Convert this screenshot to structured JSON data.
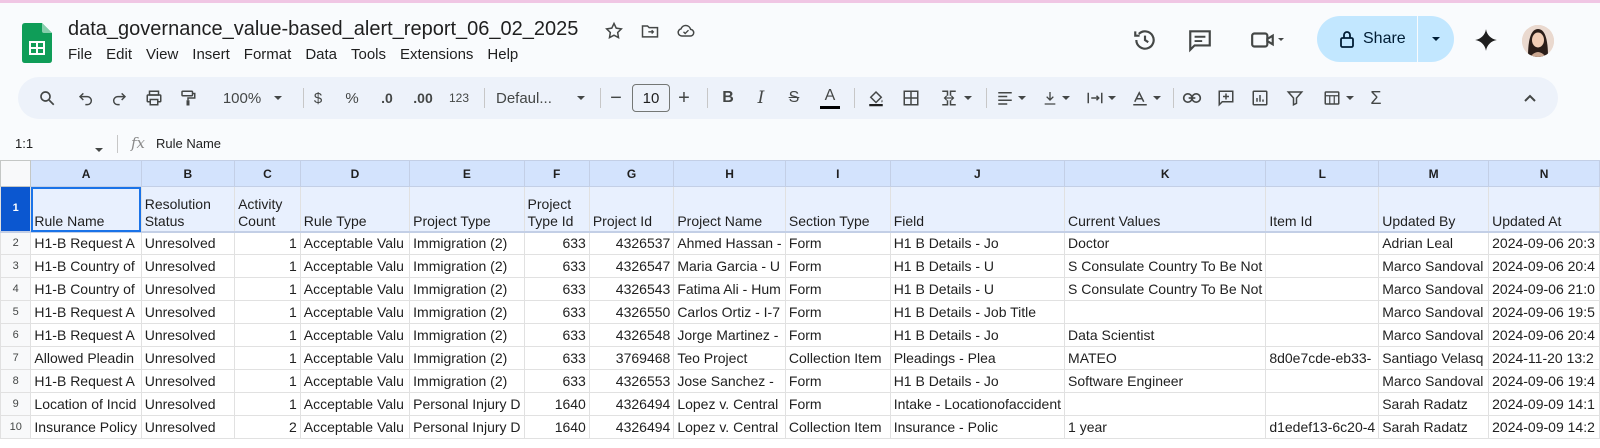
{
  "header": {
    "doc_title": "data_governance_value-based_alert_report_06_02_2025",
    "menu": [
      "File",
      "Edit",
      "View",
      "Insert",
      "Format",
      "Data",
      "Tools",
      "Extensions",
      "Help"
    ],
    "share_label": "Share"
  },
  "toolbar": {
    "zoom": "100%",
    "currency": "$",
    "percent": "%",
    "decrease_decimal": ".0",
    "increase_decimal": ".00",
    "number_format": "123",
    "font": "Defaul...",
    "font_size": "10",
    "minus": "−",
    "plus": "+",
    "bold": "B",
    "italic": "I",
    "strike": "S",
    "text_color": "A",
    "sum": "Σ"
  },
  "formula_bar": {
    "cell_ref": "1:1",
    "fx": "fx",
    "content": "Rule Name"
  },
  "columns": [
    "A",
    "B",
    "C",
    "D",
    "E",
    "F",
    "G",
    "H",
    "I",
    "J",
    "K",
    "L",
    "M",
    "N"
  ],
  "header_row": {
    "number": "1",
    "cells": [
      "Rule Name",
      "Resolution Status",
      "Activity Count",
      "Rule Type",
      "Project Type",
      "Project Type  Id",
      "Project  Id",
      "Project  Name",
      "Section Type",
      "Field",
      "Current Values",
      "Item Id",
      "Updated By",
      "Updated At"
    ]
  },
  "rows": [
    {
      "n": "2",
      "c": [
        "H1-B Request A",
        "Unresolved",
        "1",
        "Acceptable Valu",
        "Immigration (2)",
        "633",
        "4326537",
        "Ahmed Hassan -",
        "Form",
        "H1 B Details - Jo",
        "Doctor",
        "",
        "Adrian Leal",
        "2024-09-06 20:3"
      ]
    },
    {
      "n": "3",
      "c": [
        "H1-B Country of",
        "Unresolved",
        "1",
        "Acceptable Valu",
        "Immigration (2)",
        "633",
        "4326547",
        "Maria Garcia - U",
        "Form",
        "H1 B Details - U",
        "S Consulate Country To Be Not",
        "",
        "Marco Sandoval",
        "2024-09-06 20:4"
      ]
    },
    {
      "n": "4",
      "c": [
        "H1-B Country of",
        "Unresolved",
        "1",
        "Acceptable Valu",
        "Immigration (2)",
        "633",
        "4326543",
        "Fatima Ali - Hum",
        "Form",
        "H1 B Details - U",
        "S Consulate Country To Be Not",
        "",
        "Marco Sandoval",
        "2024-09-06 21:0"
      ]
    },
    {
      "n": "5",
      "c": [
        "H1-B Request A",
        "Unresolved",
        "1",
        "Acceptable Valu",
        "Immigration (2)",
        "633",
        "4326550",
        "Carlos Ortiz - I-7",
        "Form",
        "H1 B Details - Job Title",
        "",
        "",
        "Marco Sandoval",
        "2024-09-06 19:5"
      ]
    },
    {
      "n": "6",
      "c": [
        "H1-B Request A",
        "Unresolved",
        "1",
        "Acceptable Valu",
        "Immigration (2)",
        "633",
        "4326548",
        "Jorge Martinez -",
        "Form",
        "H1 B Details - Jo",
        "Data Scientist",
        "",
        "Marco Sandoval",
        "2024-09-06 20:4"
      ]
    },
    {
      "n": "7",
      "c": [
        "Allowed Pleadin",
        "Unresolved",
        "1",
        "Acceptable Valu",
        "Immigration (2)",
        "633",
        "3769468",
        "Teo Project",
        "Collection Item",
        "Pleadings - Plea",
        "MATEO",
        "8d0e7cde-eb33-",
        "Santiago Velasq",
        "2024-11-20 13:2"
      ]
    },
    {
      "n": "8",
      "c": [
        "H1-B Request A",
        "Unresolved",
        "1",
        "Acceptable Valu",
        "Immigration (2)",
        "633",
        "4326553",
        "Jose Sanchez - ",
        "Form",
        "H1 B Details - Jo",
        "Software Engineer",
        "",
        "Marco Sandoval",
        "2024-09-06 19:4"
      ]
    },
    {
      "n": "9",
      "c": [
        "Location of Incid",
        "Unresolved",
        "1",
        "Acceptable Valu",
        "Personal Injury D",
        "1640",
        "4326494",
        "Lopez v. Central",
        "Form",
        "Intake - Locationofaccident",
        "",
        "",
        "Sarah Radatz",
        "2024-09-09 14:1"
      ]
    },
    {
      "n": "10",
      "c": [
        "Insurance Policy",
        "Unresolved",
        "2",
        "Acceptable Valu",
        "Personal Injury D",
        "1640",
        "4326494",
        "Lopez v. Central",
        "Collection Item",
        "Insurance - Polic",
        "1 year",
        "d1edef13-6c20-4",
        "Sarah Radatz",
        "2024-09-09 14:2"
      ]
    }
  ]
}
